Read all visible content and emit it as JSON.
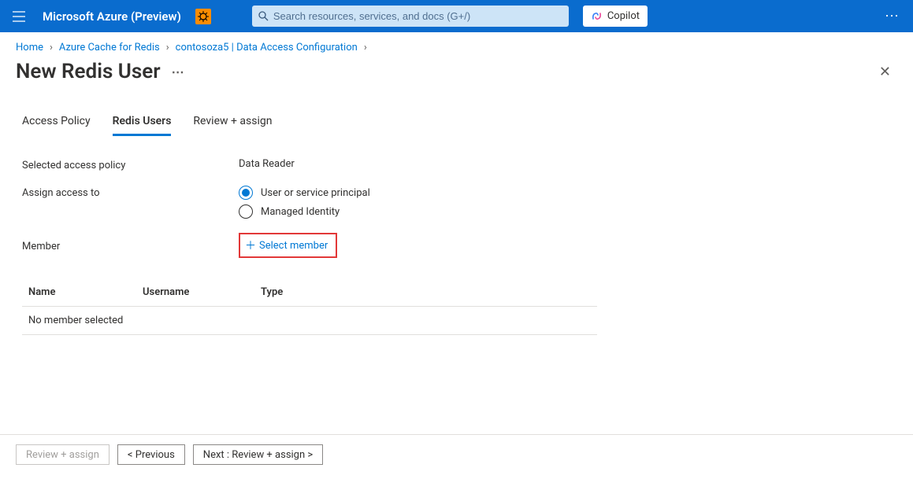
{
  "header": {
    "brand": "Microsoft Azure (Preview)",
    "search_placeholder": "Search resources, services, and docs (G+/)",
    "copilot_label": "Copilot"
  },
  "breadcrumb": {
    "items": [
      "Home",
      "Azure Cache for Redis",
      "contosoza5 | Data Access Configuration"
    ]
  },
  "page": {
    "title": "New Redis User"
  },
  "tabs": {
    "items": [
      {
        "label": "Access Policy",
        "active": false
      },
      {
        "label": "Redis Users",
        "active": true
      },
      {
        "label": "Review + assign",
        "active": false
      }
    ]
  },
  "form": {
    "selected_policy_label": "Selected access policy",
    "selected_policy_value": "Data Reader",
    "assign_label": "Assign access to",
    "radio_user": "User or service principal",
    "radio_mi": "Managed Identity",
    "member_label": "Member",
    "select_member_link": "Select member"
  },
  "table": {
    "col_name": "Name",
    "col_username": "Username",
    "col_type": "Type",
    "empty_text": "No member selected"
  },
  "footer": {
    "review_assign": "Review + assign",
    "previous": "< Previous",
    "next": "Next : Review + assign >"
  }
}
